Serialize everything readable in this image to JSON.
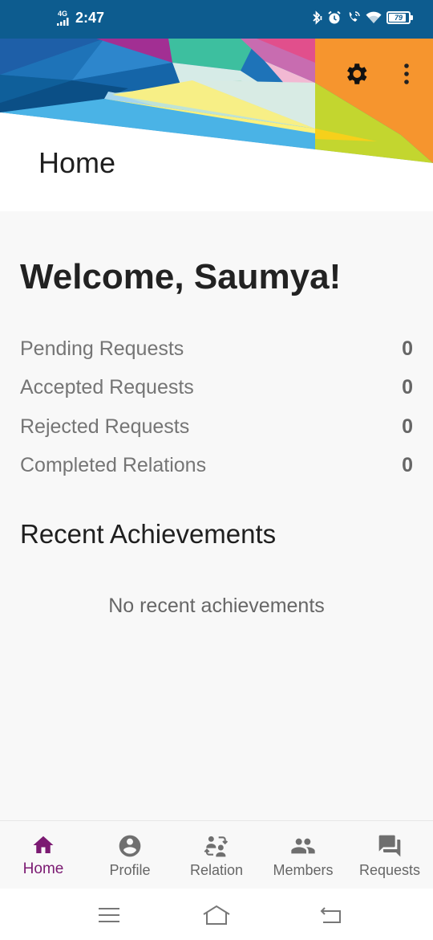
{
  "status_bar": {
    "network": "4G",
    "time": "2:47",
    "battery": "79",
    "battery_level": 0.79
  },
  "header": {
    "title": "Home",
    "settings_icon": "gear-icon",
    "more_icon": "more-vert-icon"
  },
  "main": {
    "welcome": "Welcome, Saumya!",
    "stats": [
      {
        "label": "Pending Requests",
        "value": "0"
      },
      {
        "label": "Accepted Requests",
        "value": "0"
      },
      {
        "label": "Rejected Requests",
        "value": "0"
      },
      {
        "label": "Completed Relations",
        "value": "0"
      }
    ],
    "achievements_title": "Recent Achievements",
    "achievements_empty": "No recent achievements"
  },
  "bottom_nav": {
    "items": [
      {
        "label": "Home",
        "icon": "home-icon",
        "active": true
      },
      {
        "label": "Profile",
        "icon": "account-circle-icon",
        "active": false
      },
      {
        "label": "Relation",
        "icon": "people-swap-icon",
        "active": false
      },
      {
        "label": "Members",
        "icon": "group-icon",
        "active": false
      },
      {
        "label": "Requests",
        "icon": "forum-icon",
        "active": false
      }
    ]
  },
  "colors": {
    "status_bar": "#0d5c8f",
    "accent": "#7b1a72",
    "inactive_icon": "#6f6f6f"
  }
}
